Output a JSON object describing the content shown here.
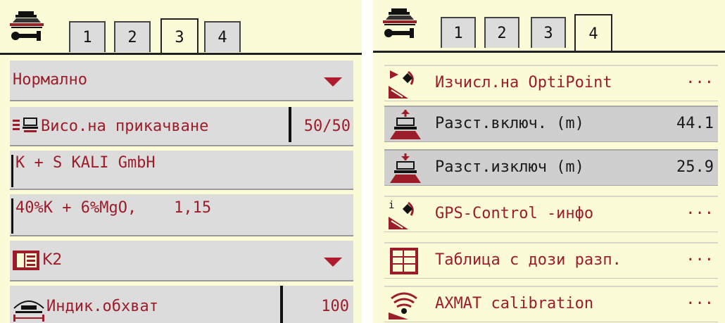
{
  "left_panel": {
    "tabs": [
      {
        "label": "1",
        "active": false
      },
      {
        "label": "2",
        "active": false
      },
      {
        "label": "3",
        "active": true
      },
      {
        "label": "4",
        "active": false
      }
    ],
    "mode_select": {
      "value": "Нормално"
    },
    "hitch_height": {
      "label": "Висо.на прикачване",
      "value": "50/50"
    },
    "fertilizer_maker": {
      "value": "K + S KALI GmbH"
    },
    "fertilizer_composition": {
      "value": "40%K + 6%MgO,    1,15"
    },
    "disc_select": {
      "value": "K2"
    },
    "working_width": {
      "label": "Индик.обхват",
      "value": "100"
    }
  },
  "right_panel": {
    "tabs": [
      {
        "label": "1",
        "active": false
      },
      {
        "label": "2",
        "active": false
      },
      {
        "label": "3",
        "active": false
      },
      {
        "label": "4",
        "active": true
      }
    ],
    "items": [
      {
        "label": "Изчисл.на OptiPoint",
        "value": "···",
        "icon": "optipoint-calc-icon",
        "highlighted": false
      },
      {
        "label": "Разст.включ. (m)",
        "value": "44.1",
        "icon": "distance-on-icon",
        "highlighted": true
      },
      {
        "label": "Разст.изключ (m)",
        "value": "25.9",
        "icon": "distance-off-icon",
        "highlighted": true
      },
      {
        "label": "GPS-Control -инфо",
        "value": "···",
        "icon": "gps-info-icon",
        "highlighted": false
      },
      {
        "label": "Таблица с дози разп.",
        "value": "···",
        "icon": "spread-table-icon",
        "highlighted": false
      },
      {
        "label": "AXMAT calibration",
        "value": "···",
        "icon": "axmat-calibration-icon",
        "highlighted": false
      }
    ]
  },
  "colors": {
    "background": "#fbfbd7",
    "row_gray": "#dcdcdc",
    "accent_red": "#9b1d2a"
  }
}
